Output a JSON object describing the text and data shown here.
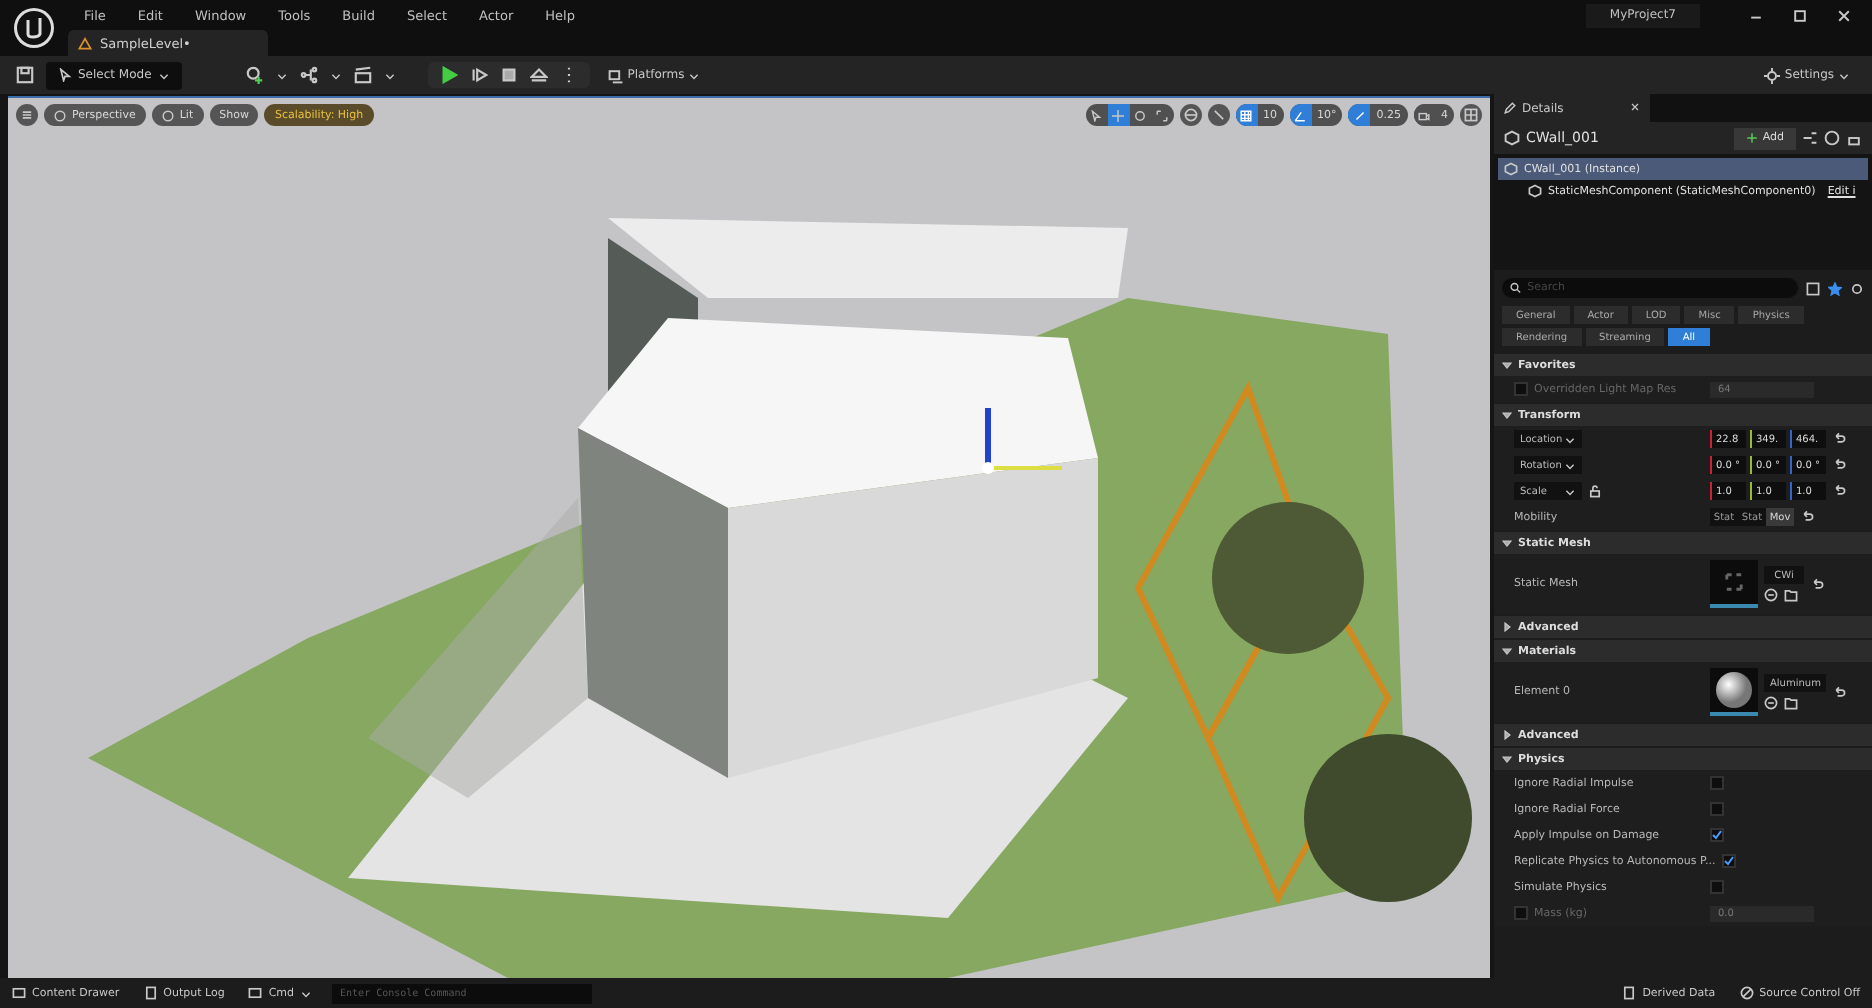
{
  "menu": [
    "File",
    "Edit",
    "Window",
    "Tools",
    "Build",
    "Select",
    "Actor",
    "Help"
  ],
  "level_tab": {
    "label": "SampleLevel•"
  },
  "project": "MyProject7",
  "toolbar": {
    "mode": "Select Mode",
    "platforms": "Platforms",
    "settings": "Settings"
  },
  "viewport": {
    "left_buttons": [
      {
        "label": "Perspective",
        "kind": "icon"
      },
      {
        "label": "Lit",
        "kind": "icon"
      },
      {
        "label": "Show",
        "kind": "plain"
      },
      {
        "label": "Scalability: High",
        "kind": "warn"
      }
    ],
    "tools": [
      {
        "selected": false
      },
      {
        "selected": true
      },
      {
        "selected": false
      },
      {
        "selected": false
      }
    ],
    "grid": "10",
    "angle": "10°",
    "scale": "0.25",
    "camera": "4"
  },
  "details": {
    "tab": "Details",
    "actor": "CWall_001",
    "add": "Add",
    "tree": [
      {
        "label": "CWall_001 (Instance)",
        "selected": true,
        "children": [
          {
            "label": "StaticMeshComponent (StaticMeshComponent0)",
            "selected": false,
            "edit": "Edit i"
          }
        ]
      }
    ],
    "search": {
      "placeholder": "Search"
    },
    "filters": [
      {
        "label": "General",
        "selected": false
      },
      {
        "label": "Actor",
        "selected": false
      },
      {
        "label": "LOD",
        "selected": false
      },
      {
        "label": "Misc",
        "selected": false
      },
      {
        "label": "Physics",
        "selected": false
      },
      {
        "label": "Rendering",
        "selected": false
      },
      {
        "label": "Streaming",
        "selected": false
      },
      {
        "label": "All",
        "selected": true
      }
    ],
    "sections": [
      {
        "title": "Favorites",
        "expanded": true,
        "rows": [
          {
            "kind": "checkvalue",
            "label": "Overridden Light Map Res",
            "checked": false,
            "disabled": true,
            "value": "64"
          }
        ]
      },
      {
        "title": "Transform",
        "expanded": true,
        "rows": [
          {
            "kind": "vector",
            "label": "Location",
            "values": [
              "22.8",
              "349.",
              "464."
            ],
            "lock": false
          },
          {
            "kind": "vector",
            "label": "Rotation",
            "values": [
              "0.0 °",
              "0.0 °",
              "0.0 °"
            ],
            "lock": false
          },
          {
            "kind": "vector",
            "label": "Scale",
            "values": [
              "1.0",
              "1.0",
              "1.0"
            ],
            "lock": true
          },
          {
            "kind": "choice",
            "label": "Mobility",
            "options": [
              {
                "label": "Stat",
                "selected": false
              },
              {
                "label": "Stat",
                "selected": false
              },
              {
                "label": "Mov",
                "selected": true
              }
            ]
          }
        ]
      },
      {
        "title": "Static Mesh",
        "expanded": true,
        "rows": [
          {
            "kind": "mesh_asset",
            "label": "Static Mesh",
            "asset": "CWi"
          }
        ]
      },
      {
        "title": "Advanced",
        "expanded": false
      },
      {
        "title": "Materials",
        "expanded": true,
        "rows": [
          {
            "kind": "material_asset",
            "label": "Element 0",
            "asset": "Aluminum"
          }
        ]
      },
      {
        "title": "Advanced",
        "expanded": false
      },
      {
        "title": "Physics",
        "expanded": true,
        "rows": [
          {
            "kind": "check",
            "label": "Ignore Radial Impulse",
            "checked": false
          },
          {
            "kind": "check",
            "label": "Ignore Radial Force",
            "checked": false
          },
          {
            "kind": "check",
            "label": "Apply Impulse on Damage",
            "checked": true
          },
          {
            "kind": "check",
            "label": "Replicate Physics to Autonomous P...",
            "checked": true
          },
          {
            "kind": "check",
            "label": "Simulate Physics",
            "checked": false
          },
          {
            "kind": "checkvalue",
            "label": "Mass (kg)",
            "checked": false,
            "disabled": true,
            "value": "0.0"
          }
        ]
      }
    ]
  },
  "status": {
    "content_drawer": "Content Drawer",
    "output_log": "Output Log",
    "cmd": "Cmd",
    "console": {
      "placeholder": "Enter Console Command"
    },
    "derived": "Derived Data",
    "source_control": "Source Control Off"
  }
}
